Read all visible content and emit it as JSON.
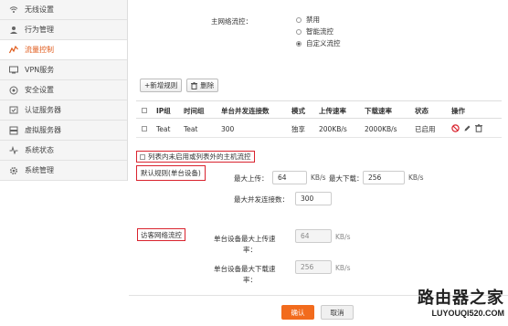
{
  "sidebar": {
    "items": [
      {
        "label": "无线设置",
        "icon": "wifi-icon"
      },
      {
        "label": "行为管理",
        "icon": "user-icon"
      },
      {
        "label": "流量控制",
        "icon": "traffic-icon",
        "active": true
      },
      {
        "label": "VPN服务",
        "icon": "vpn-icon"
      },
      {
        "label": "安全设置",
        "icon": "shield-icon"
      },
      {
        "label": "认证服务器",
        "icon": "auth-icon"
      },
      {
        "label": "虚拟服务器",
        "icon": "server-icon"
      },
      {
        "label": "系统状态",
        "icon": "pulse-icon"
      },
      {
        "label": "系统管理",
        "icon": "gear-icon"
      }
    ],
    "active_color": "#e05a1a"
  },
  "mode": {
    "label": "主网络流控：",
    "options": [
      {
        "label": "禁用",
        "checked": false
      },
      {
        "label": "智能流控",
        "checked": false
      },
      {
        "label": "自定义流控",
        "checked": true
      }
    ]
  },
  "toolbar": {
    "add_label": "+新增规则",
    "delete_label": "删除"
  },
  "table": {
    "headers": [
      "IP组",
      "时间组",
      "单台并发连接数",
      "模式",
      "上传速率",
      "下载速率",
      "状态",
      "操作"
    ],
    "rows": [
      {
        "ip_group": "Teat",
        "time_group": "Teat",
        "concurrency": "300",
        "mode": "独享",
        "upload": "200KB/s",
        "download": "2000KB/s",
        "status": "已启用"
      }
    ]
  },
  "unlisted_hosts": {
    "label": "列表内未启用或列表外的主机流控"
  },
  "default_rule": {
    "title": "默认规则(单台设备)",
    "max_upload_label": "最大上传：",
    "max_upload_value": "64",
    "max_upload_unit": "KB/s",
    "max_download_label": "最大下载：",
    "max_download_value": "256",
    "max_download_unit": "KB/s",
    "max_conn_label": "最大并发连接数：",
    "max_conn_value": "300"
  },
  "guest": {
    "title": "访客网络流控",
    "upload_label_1": "单台设备最大上传速",
    "upload_label_2": "率：",
    "upload_value": "64",
    "upload_unit": "KB/s",
    "download_label_1": "单台设备最大下载速",
    "download_label_2": "率：",
    "download_value": "256",
    "download_unit": "KB/s"
  },
  "actions": {
    "confirm": "确认",
    "cancel": "取消"
  },
  "watermark": {
    "title": "路由器之家",
    "url": "LUYOUQI520.COM"
  },
  "colors": {
    "accent": "#f26b1d",
    "highlight_box": "#d9232e",
    "enabled_status": "#333333"
  }
}
